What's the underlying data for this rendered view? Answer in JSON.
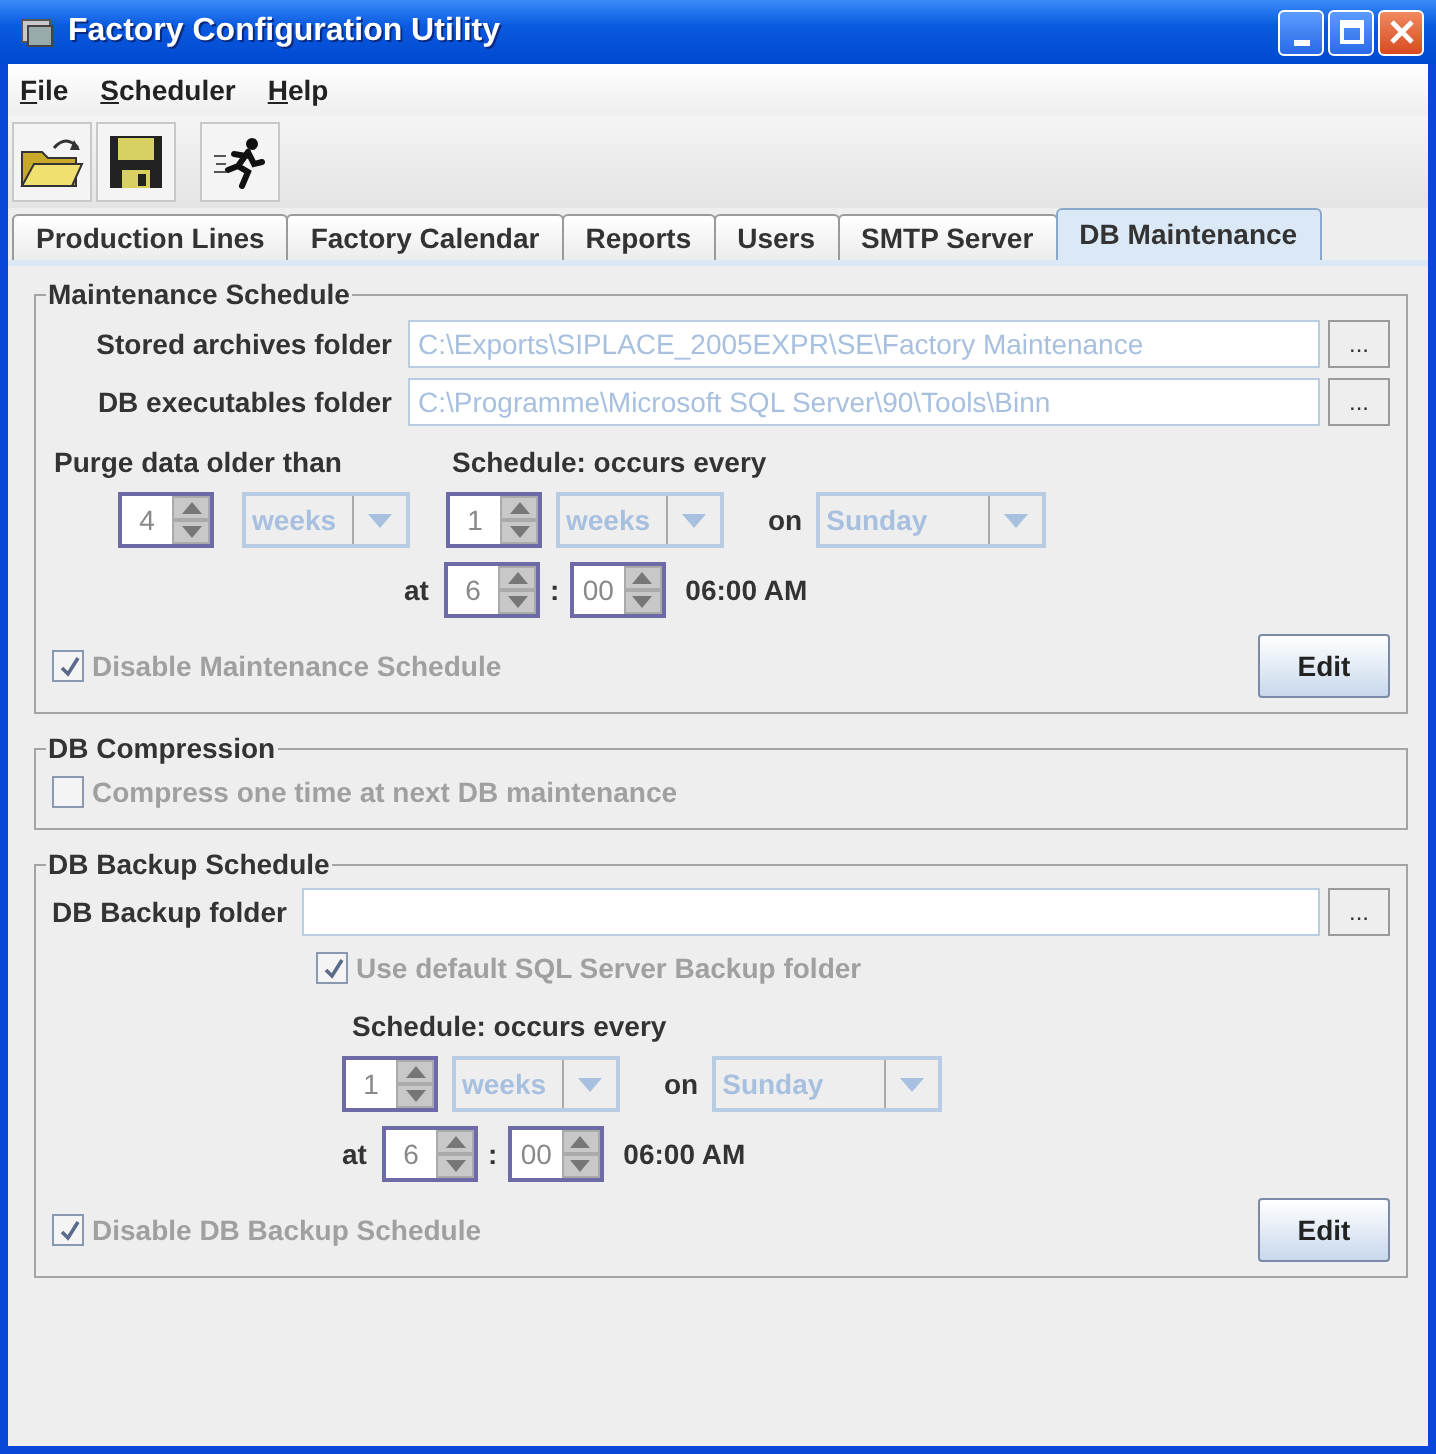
{
  "window": {
    "title": "Factory Configuration Utility"
  },
  "menu": [
    {
      "label": "File"
    },
    {
      "label": "Scheduler"
    },
    {
      "label": "Help"
    }
  ],
  "tabs": [
    {
      "label": "Production Lines",
      "selected": false
    },
    {
      "label": "Factory Calendar",
      "selected": false
    },
    {
      "label": "Reports",
      "selected": false
    },
    {
      "label": "Users",
      "selected": false
    },
    {
      "label": "SMTP Server",
      "selected": false
    },
    {
      "label": "DB Maintenance",
      "selected": true
    }
  ],
  "maintenance": {
    "title": "Maintenance Schedule",
    "folders": [
      {
        "label": "Stored archives folder",
        "value": "C:\\Exports\\SIPLACE_2005EXPR\\SE\\Factory Maintenance",
        "browse": "...",
        "disabled": true
      },
      {
        "label": "DB executables folder",
        "value": "C:\\Programme\\Microsoft SQL Server\\90\\Tools\\Binn",
        "browse": "...",
        "disabled": true
      }
    ],
    "purge": {
      "label": "Purge data older than",
      "count": "4",
      "unit": "weeks"
    },
    "schedule": {
      "label": "Schedule:  occurs every",
      "count": "1",
      "unit": "weeks",
      "on_label": "on",
      "day": "Sunday",
      "at_label": "at",
      "hour": "6",
      "separator": ":",
      "minute": "00",
      "time": "06:00 AM"
    },
    "disable": {
      "label": "Disable Maintenance Schedule",
      "checked": true,
      "disabled": true
    },
    "edit": "Edit"
  },
  "compression": {
    "title": "DB Compression",
    "option": {
      "label": "Compress one time at next DB maintenance",
      "checked": false,
      "disabled": true
    }
  },
  "backup": {
    "title": "DB Backup Schedule",
    "folder": {
      "label": "DB Backup folder",
      "browse": "..."
    },
    "use_default": {
      "label": "Use default SQL Server Backup folder",
      "checked": true,
      "disabled": true
    },
    "schedule": {
      "label": "Schedule:  occurs every",
      "count": "1",
      "unit": "weeks",
      "on_label": "on",
      "day": "Sunday",
      "at_label": "at",
      "hour": "6",
      "separator": ":",
      "minute": "00",
      "time": "06:00 AM"
    },
    "disable": {
      "label": "Disable DB Backup Schedule",
      "checked": true,
      "disabled": true
    },
    "edit": "Edit"
  }
}
